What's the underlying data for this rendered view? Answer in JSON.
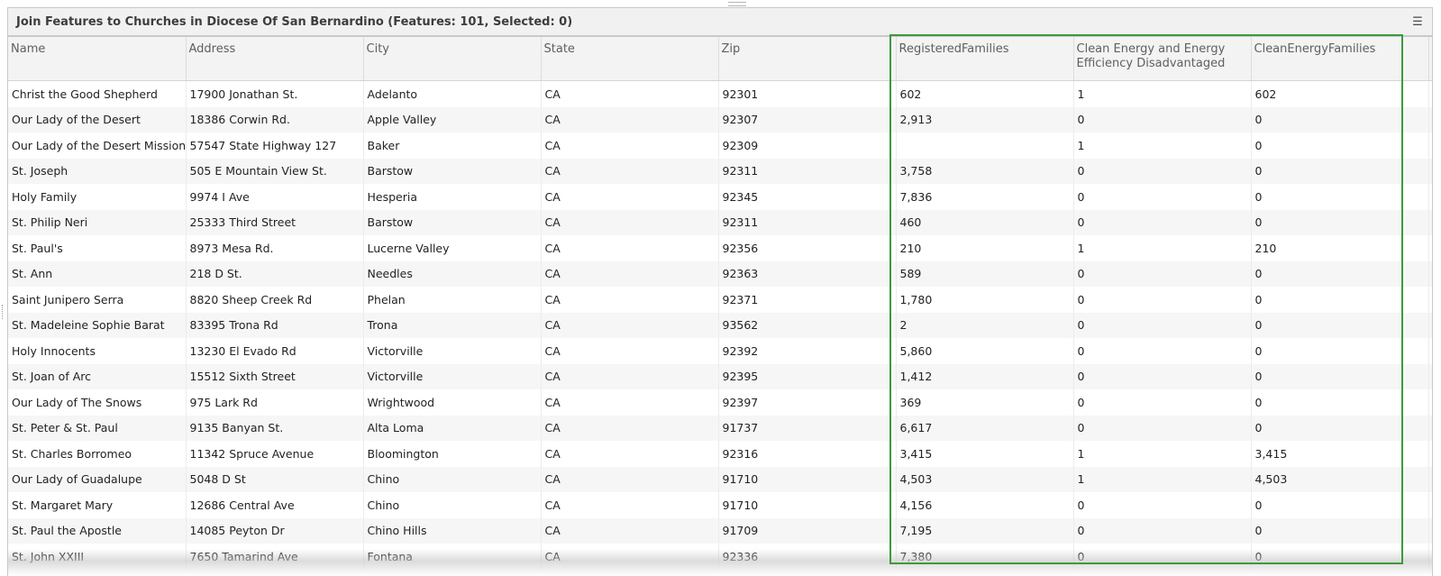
{
  "title": "Join Features to Churches in Diocese Of San Bernardino (Features: 101, Selected: 0)",
  "icons": {
    "menu": "hamburger-menu-icon"
  },
  "highlight_color": "#3c9a3c",
  "columns": [
    "Name",
    "Address",
    "City",
    "State",
    "Zip",
    "RegisteredFamilies",
    "Clean Energy and Energy Efficiency Disadvantaged",
    "CleanEnergyFamilies"
  ],
  "rows": [
    [
      "Christ the Good Shepherd",
      "17900 Jonathan St.",
      "Adelanto",
      "CA",
      "92301",
      "602",
      "1",
      "602"
    ],
    [
      "Our Lady of the Desert",
      "18386 Corwin Rd.",
      "Apple Valley",
      "CA",
      "92307",
      "2,913",
      "0",
      "0"
    ],
    [
      "Our Lady of the Desert Mission",
      "57547 State Highway 127",
      "Baker",
      "CA",
      "92309",
      "",
      "1",
      "0"
    ],
    [
      "St. Joseph",
      "505 E Mountain View St.",
      "Barstow",
      "CA",
      "92311",
      "3,758",
      "0",
      "0"
    ],
    [
      "Holy Family",
      "9974 I Ave",
      "Hesperia",
      "CA",
      "92345",
      "7,836",
      "0",
      "0"
    ],
    [
      "St. Philip Neri",
      "25333 Third Street",
      "Barstow",
      "CA",
      "92311",
      "460",
      "0",
      "0"
    ],
    [
      "St. Paul's",
      "8973 Mesa Rd.",
      "Lucerne Valley",
      "CA",
      "92356",
      "210",
      "1",
      "210"
    ],
    [
      "St. Ann",
      "218 D St.",
      "Needles",
      "CA",
      "92363",
      "589",
      "0",
      "0"
    ],
    [
      "Saint Junipero Serra",
      "8820 Sheep Creek Rd",
      "Phelan",
      "CA",
      "92371",
      "1,780",
      "0",
      "0"
    ],
    [
      "St. Madeleine Sophie Barat",
      "83395 Trona Rd",
      "Trona",
      "CA",
      "93562",
      "2",
      "0",
      "0"
    ],
    [
      "Holy Innocents",
      "13230 El Evado Rd",
      "Victorville",
      "CA",
      "92392",
      "5,860",
      "0",
      "0"
    ],
    [
      "St. Joan of Arc",
      "15512 Sixth Street",
      "Victorville",
      "CA",
      "92395",
      "1,412",
      "0",
      "0"
    ],
    [
      "Our Lady of The Snows",
      "975 Lark Rd",
      "Wrightwood",
      "CA",
      "92397",
      "369",
      "0",
      "0"
    ],
    [
      "St. Peter & St. Paul",
      "9135 Banyan St.",
      "Alta Loma",
      "CA",
      "91737",
      "6,617",
      "0",
      "0"
    ],
    [
      "St. Charles Borromeo",
      "11342 Spruce Avenue",
      "Bloomington",
      "CA",
      "92316",
      "3,415",
      "1",
      "3,415"
    ],
    [
      "Our Lady of Guadalupe",
      "5048 D St",
      "Chino",
      "CA",
      "91710",
      "4,503",
      "1",
      "4,503"
    ],
    [
      "St. Margaret Mary",
      "12686 Central Ave",
      "Chino",
      "CA",
      "91710",
      "4,156",
      "0",
      "0"
    ],
    [
      "St. Paul the Apostle",
      "14085 Peyton Dr",
      "Chino Hills",
      "CA",
      "91709",
      "7,195",
      "0",
      "0"
    ],
    [
      "St. John XXIII",
      "7650 Tamarind Ave",
      "Fontana",
      "CA",
      "92336",
      "7,380",
      "0",
      "0"
    ]
  ]
}
